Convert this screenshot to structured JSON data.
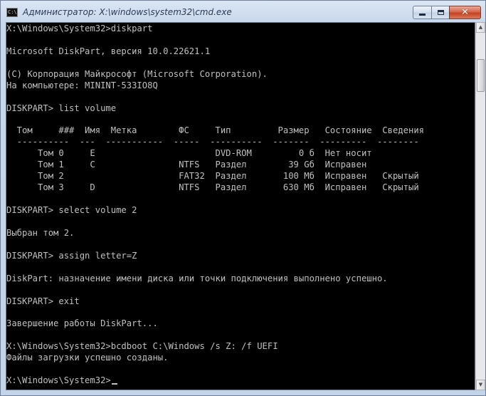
{
  "window": {
    "title": "Администратор: X:\\windows\\system32\\cmd.exe",
    "icon_text": "C:\\",
    "controls": {
      "minimize": "minimize-icon",
      "maximize": "maximize-icon",
      "close": "close-icon",
      "close_glyph": "✕"
    }
  },
  "console": {
    "lines": [
      "X:\\Windows\\System32>diskpart",
      "",
      "Microsoft DiskPart, версия 10.0.22621.1",
      "",
      "(C) Корпорация Майкрософт (Microsoft Corporation).",
      "На компьютере: MININT-533IO8Q",
      "",
      "DISKPART> list volume",
      "",
      "  Том     ###  Имя  Метка        ФС     Тип         Размер   Состояние  Сведения",
      "  ----------  ---  -----------  -----  ----------  -------  ---------  --------",
      "      Том 0     E                       DVD-ROM         0 б  Нет носит",
      "      Том 1     C                NTFS   Раздел        39 Gб  Исправен",
      "      Том 2                      FAT32  Раздел       100 Мб  Исправен   Скрытый",
      "      Том 3     D                NTFS   Раздел       630 Мб  Исправен   Скрытый",
      "",
      "DISKPART> select volume 2",
      "",
      "Выбран том 2.",
      "",
      "DISKPART> assign letter=Z",
      "",
      "DiskPart: назначение имени диска или точки подключения выполнено успешно.",
      "",
      "DISKPART> exit",
      "",
      "Завершение работы DiskPart...",
      "",
      "X:\\Windows\\System32>bcdboot C:\\Windows /s Z: /f UEFI",
      "Файлы загрузки успешно созданы.",
      "",
      "X:\\Windows\\System32>"
    ]
  },
  "colors": {
    "console_bg": "#000000",
    "console_fg": "#c0c0c0",
    "close_button": "#c44122"
  },
  "scrollbar": {
    "up_arrow": "▲",
    "down_arrow": "▼"
  }
}
